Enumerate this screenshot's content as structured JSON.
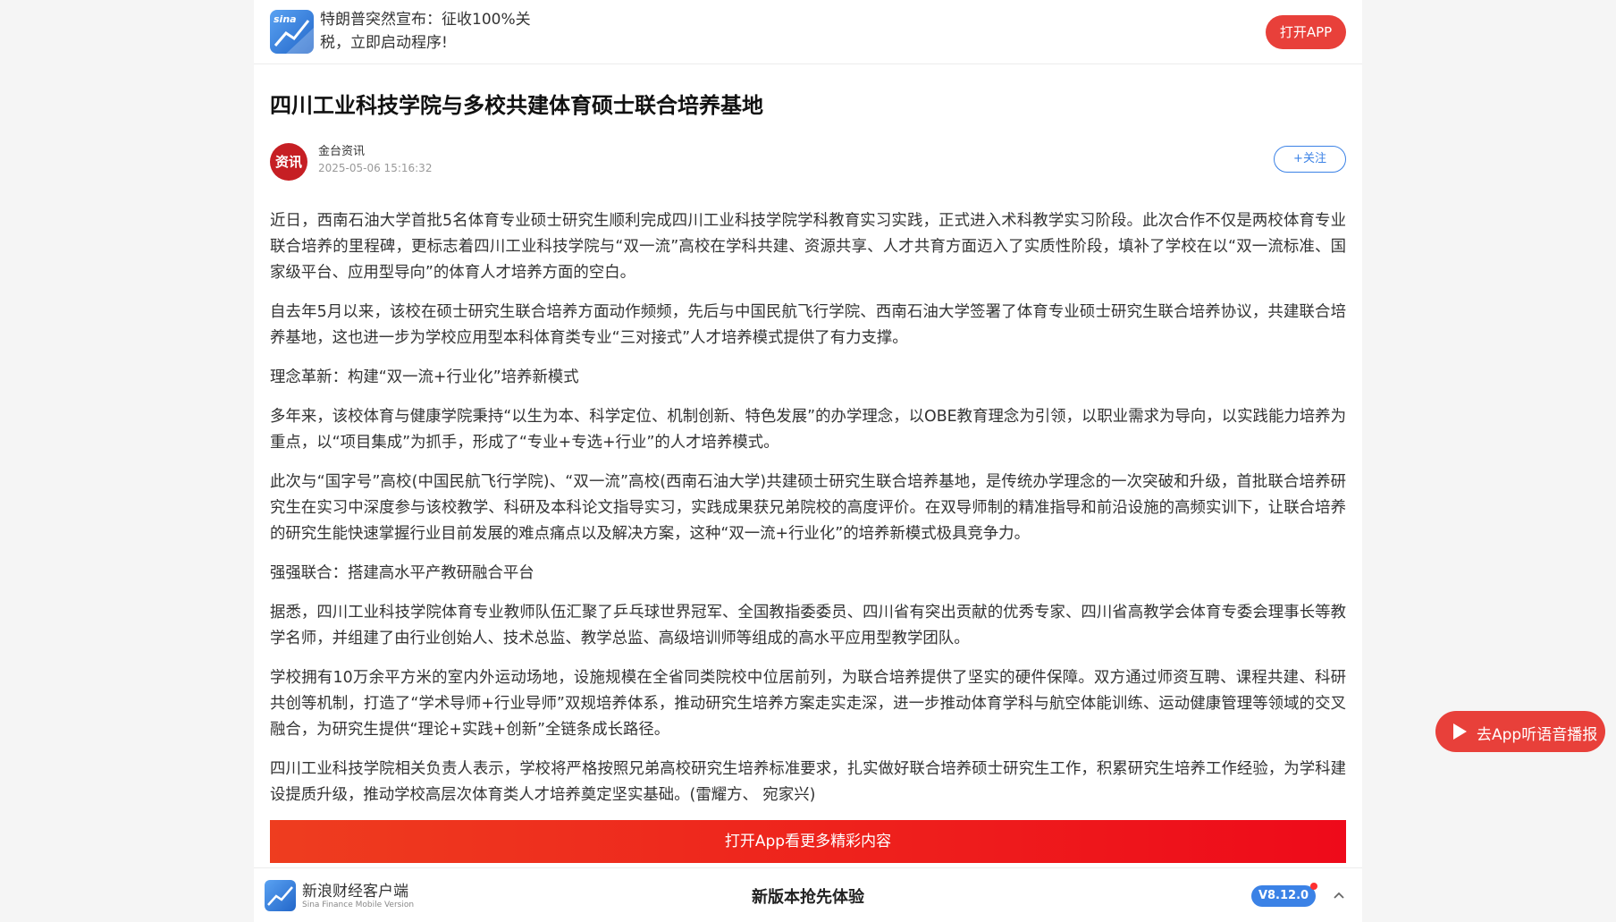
{
  "topbar": {
    "logo_text": "sina",
    "headline": "特朗普突然宣布：征收100%关税，立即启动程序!",
    "open_app_label": "打开APP"
  },
  "article": {
    "title": "四川工业科技学院与多校共建体育硕士联合培养基地",
    "author": {
      "avatar_text": "资讯",
      "name": "金台资讯",
      "time": "2025-05-06 15:16:32",
      "follow_label": "+关注"
    },
    "paragraphs": [
      "近日，西南石油大学首批5名体育专业硕士研究生顺利完成四川工业科技学院学科教育实习实践，正式进入术科教学实习阶段。此次合作不仅是两校体育专业联合培养的里程碑，更标志着四川工业科技学院与“双一流”高校在学科共建、资源共享、人才共育方面迈入了实质性阶段，填补了学校在以“双一流标准、国家级平台、应用型导向”的体育人才培养方面的空白。",
      "自去年5月以来，该校在硕士研究生联合培养方面动作频频，先后与中国民航飞行学院、西南石油大学签署了体育专业硕士研究生联合培养协议，共建联合培养基地，这也进一步为学校应用型本科体育类专业“三对接式”人才培养模式提供了有力支撑。",
      "理念革新：构建“双一流+行业化”培养新模式",
      "多年来，该校体育与健康学院秉持“以生为本、科学定位、机制创新、特色发展”的办学理念，以OBE教育理念为引领，以职业需求为导向，以实践能力培养为重点，以“项目集成”为抓手，形成了“专业+专选+行业”的人才培养模式。",
      "此次与“国字号”高校(中国民航飞行学院)、“双一流”高校(西南石油大学)共建硕士研究生联合培养基地，是传统办学理念的一次突破和升级，首批联合培养研究生在实习中深度参与该校教学、科研及本科论文指导实习，实践成果获兄弟院校的高度评价。在双导师制的精准指导和前沿设施的高频实训下，让联合培养的研究生能快速掌握行业目前发展的难点痛点以及解决方案，这种“双一流+行业化”的培养新模式极具竞争力。",
      "强强联合：搭建高水平产教研融合平台",
      "据悉，四川工业科技学院体育专业教师队伍汇聚了乒乓球世界冠军、全国教指委委员、四川省有突出贡献的优秀专家、四川省高教学会体育专委会理事长等教学名师，并组建了由行业创始人、技术总监、教学总监、高级培训师等组成的高水平应用型教学团队。",
      "学校拥有10万余平方米的室内外运动场地，设施规模在全省同类院校中位居前列，为联合培养提供了坚实的硬件保障。双方通过师资互聘、课程共建、科研共创等机制，打造了“学术导师+行业导师”双规培养体系，推动研究生培养方案走实走深，进一步推动体育学科与航空体能训练、运动健康管理等领域的交叉融合，为研究生提供“理论+实践+创新”全链条成长路径。",
      "四川工业科技学院相关负责人表示，学校将严格按照兄弟高校研究生培养标准要求，扎实做好联合培养硕士研究生工作，积累研究生培养工作经验，为学科建设提质升级，推动学校高层次体育类人才培养奠定坚实基础。(雷耀方、 宛家兴)"
    ],
    "cta_label": "打开App看更多精彩内容"
  },
  "bottombar": {
    "app_name": "新浪财经客户端",
    "app_sub": "Sina Finance Mobile Version",
    "center_text": "新版本抢先体验",
    "version": "V8.12.0"
  },
  "audio": {
    "label": "去App听语音播报"
  },
  "colors": {
    "accent_red": "#e8403a",
    "accent_blue": "#3b82e6"
  }
}
